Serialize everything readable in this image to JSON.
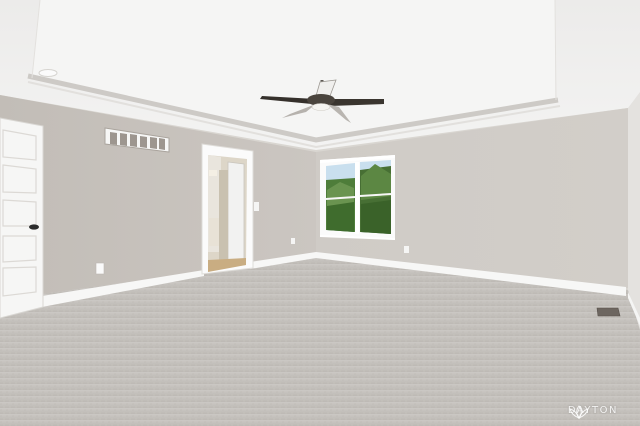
{
  "watermark": {
    "brand_text": "DAYTON",
    "icon": "lotus-logo-icon"
  },
  "colors": {
    "ceiling": "#efefee",
    "tray_ceiling": "#f4f4f3",
    "wall_left": "#c5c0ba",
    "wall_back": "#cfcac5",
    "wall_right": "#dedcd9",
    "carpet": "#c8c4c0",
    "trim": "#ffffff",
    "door": "#f6f6f5",
    "window_foliage": "#4e7d3a",
    "sky": "#c9dfee"
  }
}
